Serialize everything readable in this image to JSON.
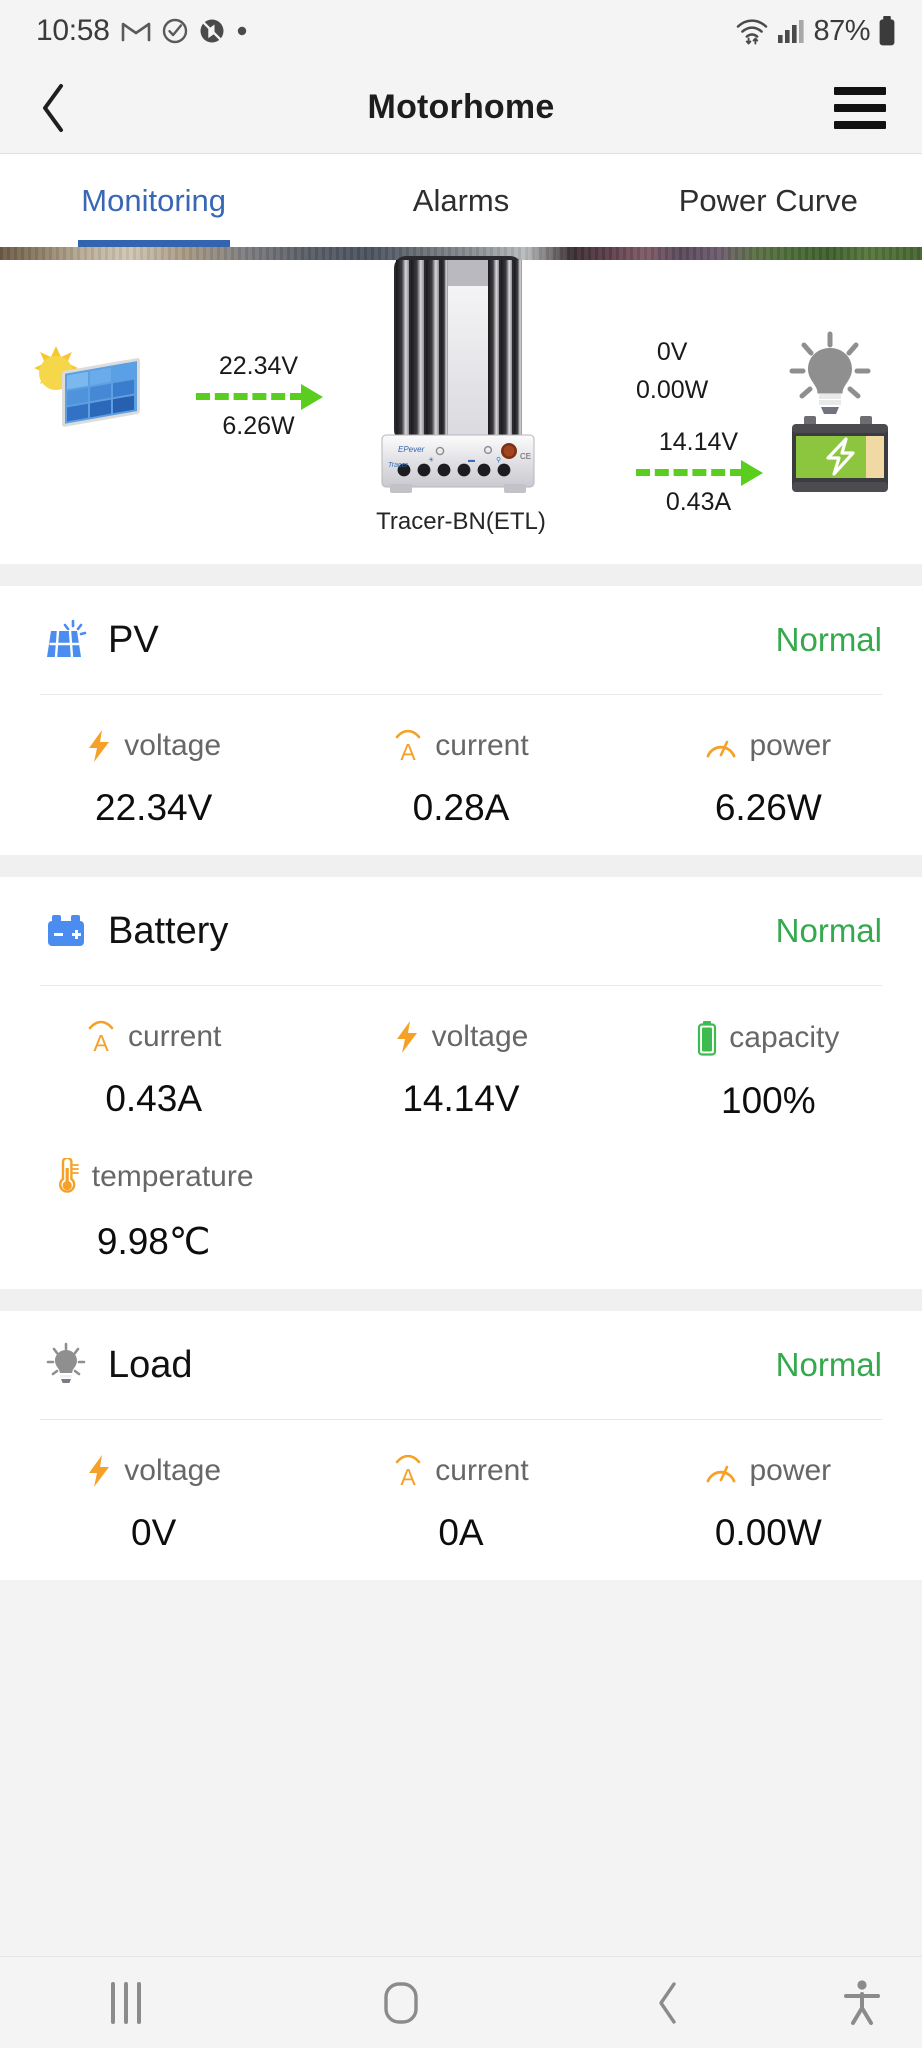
{
  "status_bar": {
    "time": "10:58",
    "battery_percent": "87%",
    "icons": [
      "gmail-icon",
      "check-circle-icon",
      "mute-icon",
      "dot-icon",
      "wifi-icon",
      "cellular-signal-icon",
      "battery-icon"
    ]
  },
  "app_bar": {
    "title": "Motorhome",
    "back_icon": "chevron-left-icon",
    "menu_icon": "hamburger-menu-icon"
  },
  "tabs": [
    {
      "label": "Monitoring",
      "active": true
    },
    {
      "label": "Alarms",
      "active": false
    },
    {
      "label": "Power Curve",
      "active": false
    }
  ],
  "diagram": {
    "device_label": "Tracer-BN(ETL)",
    "pv_flow": {
      "voltage": "22.34V",
      "power": "6.26W"
    },
    "load_flow": {
      "voltage": "0V",
      "power": "0.00W"
    },
    "battery_flow": {
      "voltage": "14.14V",
      "current": "0.43A"
    }
  },
  "sections": [
    {
      "key": "pv",
      "title": "PV",
      "status": "Normal",
      "icon": "solar-panel-icon",
      "metrics": [
        {
          "label": "voltage",
          "value": "22.34V",
          "icon": "bolt-icon"
        },
        {
          "label": "current",
          "value": "0.28A",
          "icon": "ampere-icon"
        },
        {
          "label": "power",
          "value": "6.26W",
          "icon": "gauge-icon"
        }
      ]
    },
    {
      "key": "battery",
      "title": "Battery",
      "status": "Normal",
      "icon": "battery-block-icon",
      "metrics": [
        {
          "label": "current",
          "value": "0.43A",
          "icon": "ampere-icon"
        },
        {
          "label": "voltage",
          "value": "14.14V",
          "icon": "bolt-icon"
        },
        {
          "label": "capacity",
          "value": "100%",
          "icon": "battery-level-icon"
        },
        {
          "label": "temperature",
          "value": "9.98℃",
          "icon": "thermometer-icon"
        }
      ]
    },
    {
      "key": "load",
      "title": "Load",
      "status": "Normal",
      "icon": "lightbulb-icon",
      "metrics": [
        {
          "label": "voltage",
          "value": "0V",
          "icon": "bolt-icon"
        },
        {
          "label": "current",
          "value": "0A",
          "icon": "ampere-icon"
        },
        {
          "label": "power",
          "value": "0.00W",
          "icon": "gauge-icon"
        }
      ]
    }
  ],
  "nav_bar": {
    "recent_icon": "recent-apps-icon",
    "home_icon": "home-icon",
    "back_icon": "back-icon",
    "accessibility_icon": "accessibility-icon"
  },
  "colors": {
    "accent_blue": "#3264b0",
    "status_green": "#35a94d",
    "flow_green": "#5ace1f",
    "metric_orange": "#f5a128",
    "icon_blue": "#4a8cf0"
  }
}
